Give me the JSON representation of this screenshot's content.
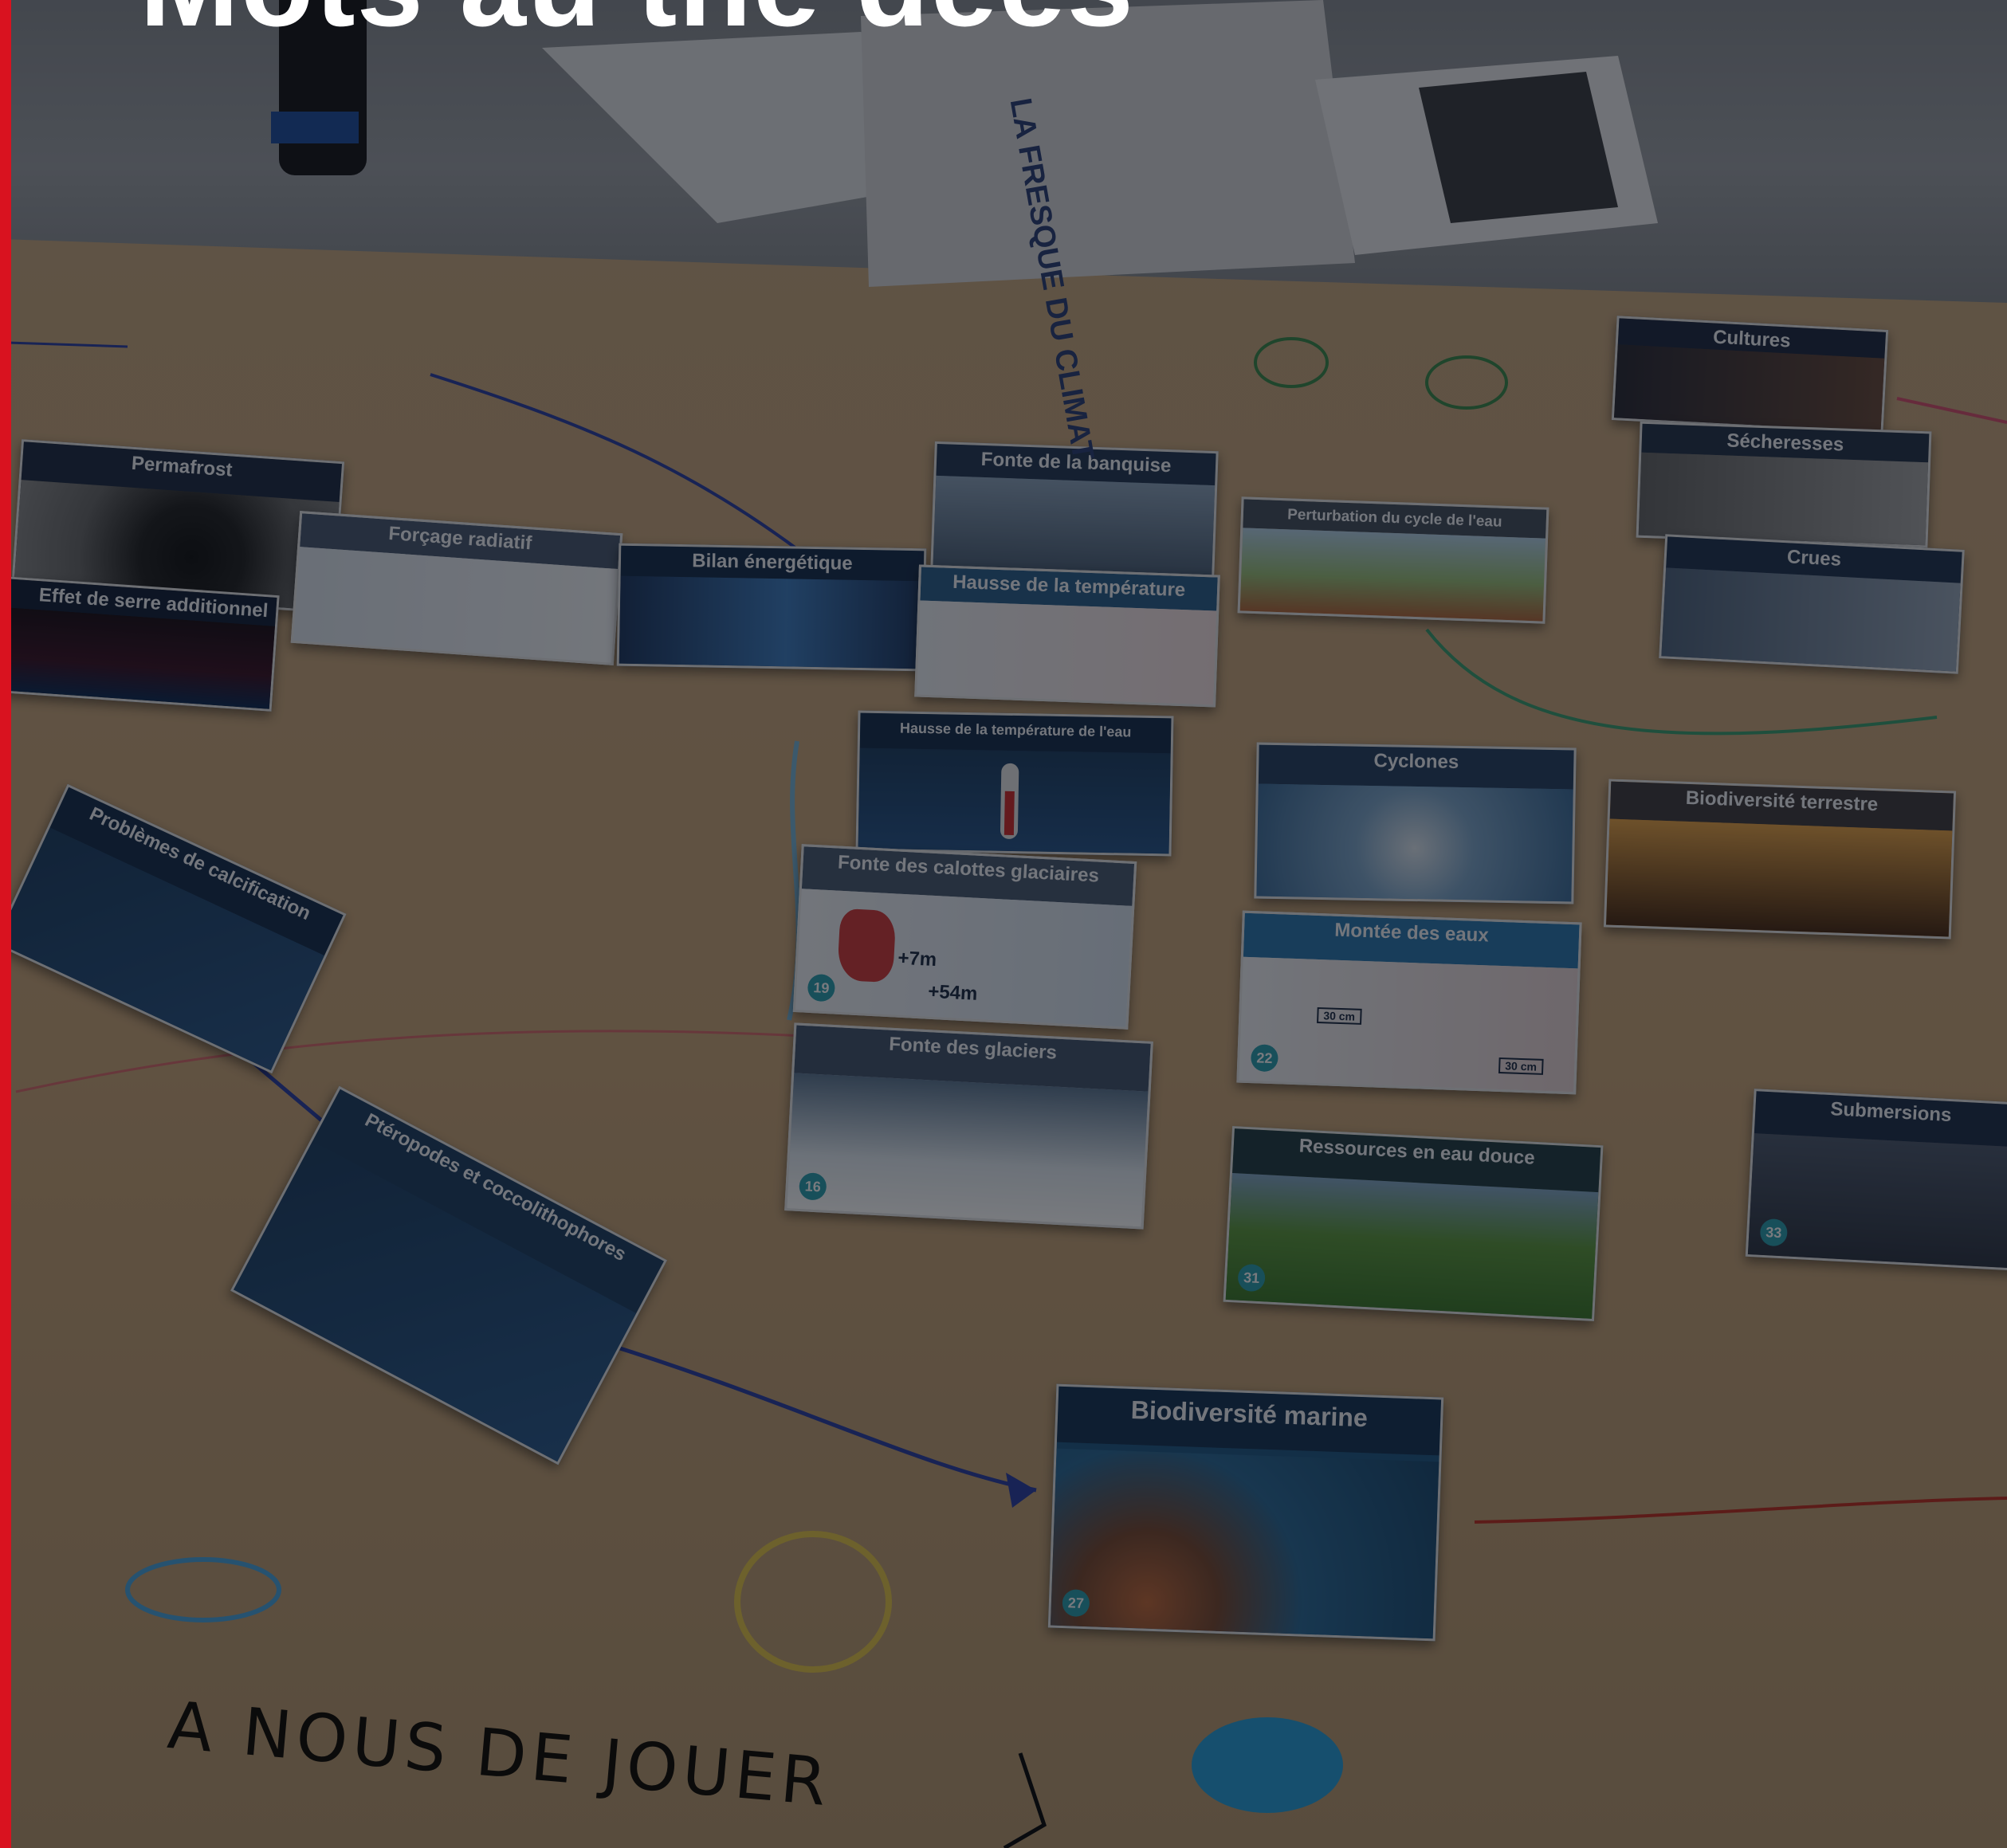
{
  "headline": "Mots au the dees",
  "logo_text": "LA FRESQUE DU CLIMAT",
  "handwriting": "A NOUS DE JOUER",
  "colors": {
    "accent_bar": "#d9121f",
    "paper": "#c9a97e",
    "card_blue": "#1d3f63",
    "badge": "#2a9fb0"
  },
  "cards": [
    {
      "title": "Permafrost",
      "number": ""
    },
    {
      "title": "Effet de serre additionnel",
      "number": ""
    },
    {
      "title": "Forçage radiatif",
      "number": ""
    },
    {
      "title": "Bilan énergétique",
      "number": ""
    },
    {
      "title": "Fonte de la banquise",
      "number": ""
    },
    {
      "title": "Hausse de la température",
      "number": ""
    },
    {
      "title": "Perturbation du cycle de l'eau",
      "number": ""
    },
    {
      "title": "Cultures",
      "number": ""
    },
    {
      "title": "Sécheresses",
      "number": ""
    },
    {
      "title": "Crues",
      "number": ""
    },
    {
      "title": "Hausse de la température de l'eau",
      "number": ""
    },
    {
      "title": "Cyclones",
      "number": ""
    },
    {
      "title": "Biodiversité terrestre",
      "number": ""
    },
    {
      "title": "Problèmes de calcification",
      "number": ""
    },
    {
      "title": "Fonte des calottes glaciaires",
      "number": "19"
    },
    {
      "title": "Montée des eaux",
      "number": "22"
    },
    {
      "title": "Fonte des glaciers",
      "number": "16"
    },
    {
      "title": "Submersions",
      "number": "33"
    },
    {
      "title": "Ptéropodes et coccolithophores",
      "number": ""
    },
    {
      "title": "Ressources en eau douce",
      "number": "31"
    },
    {
      "title": "Biodiversité marine",
      "number": "27"
    }
  ],
  "card_marks": {
    "plus_7m": "+7m",
    "plus_54m": "+54m",
    "mark_30cm_a": "30 cm",
    "mark_30cm_b": "30 cm"
  }
}
